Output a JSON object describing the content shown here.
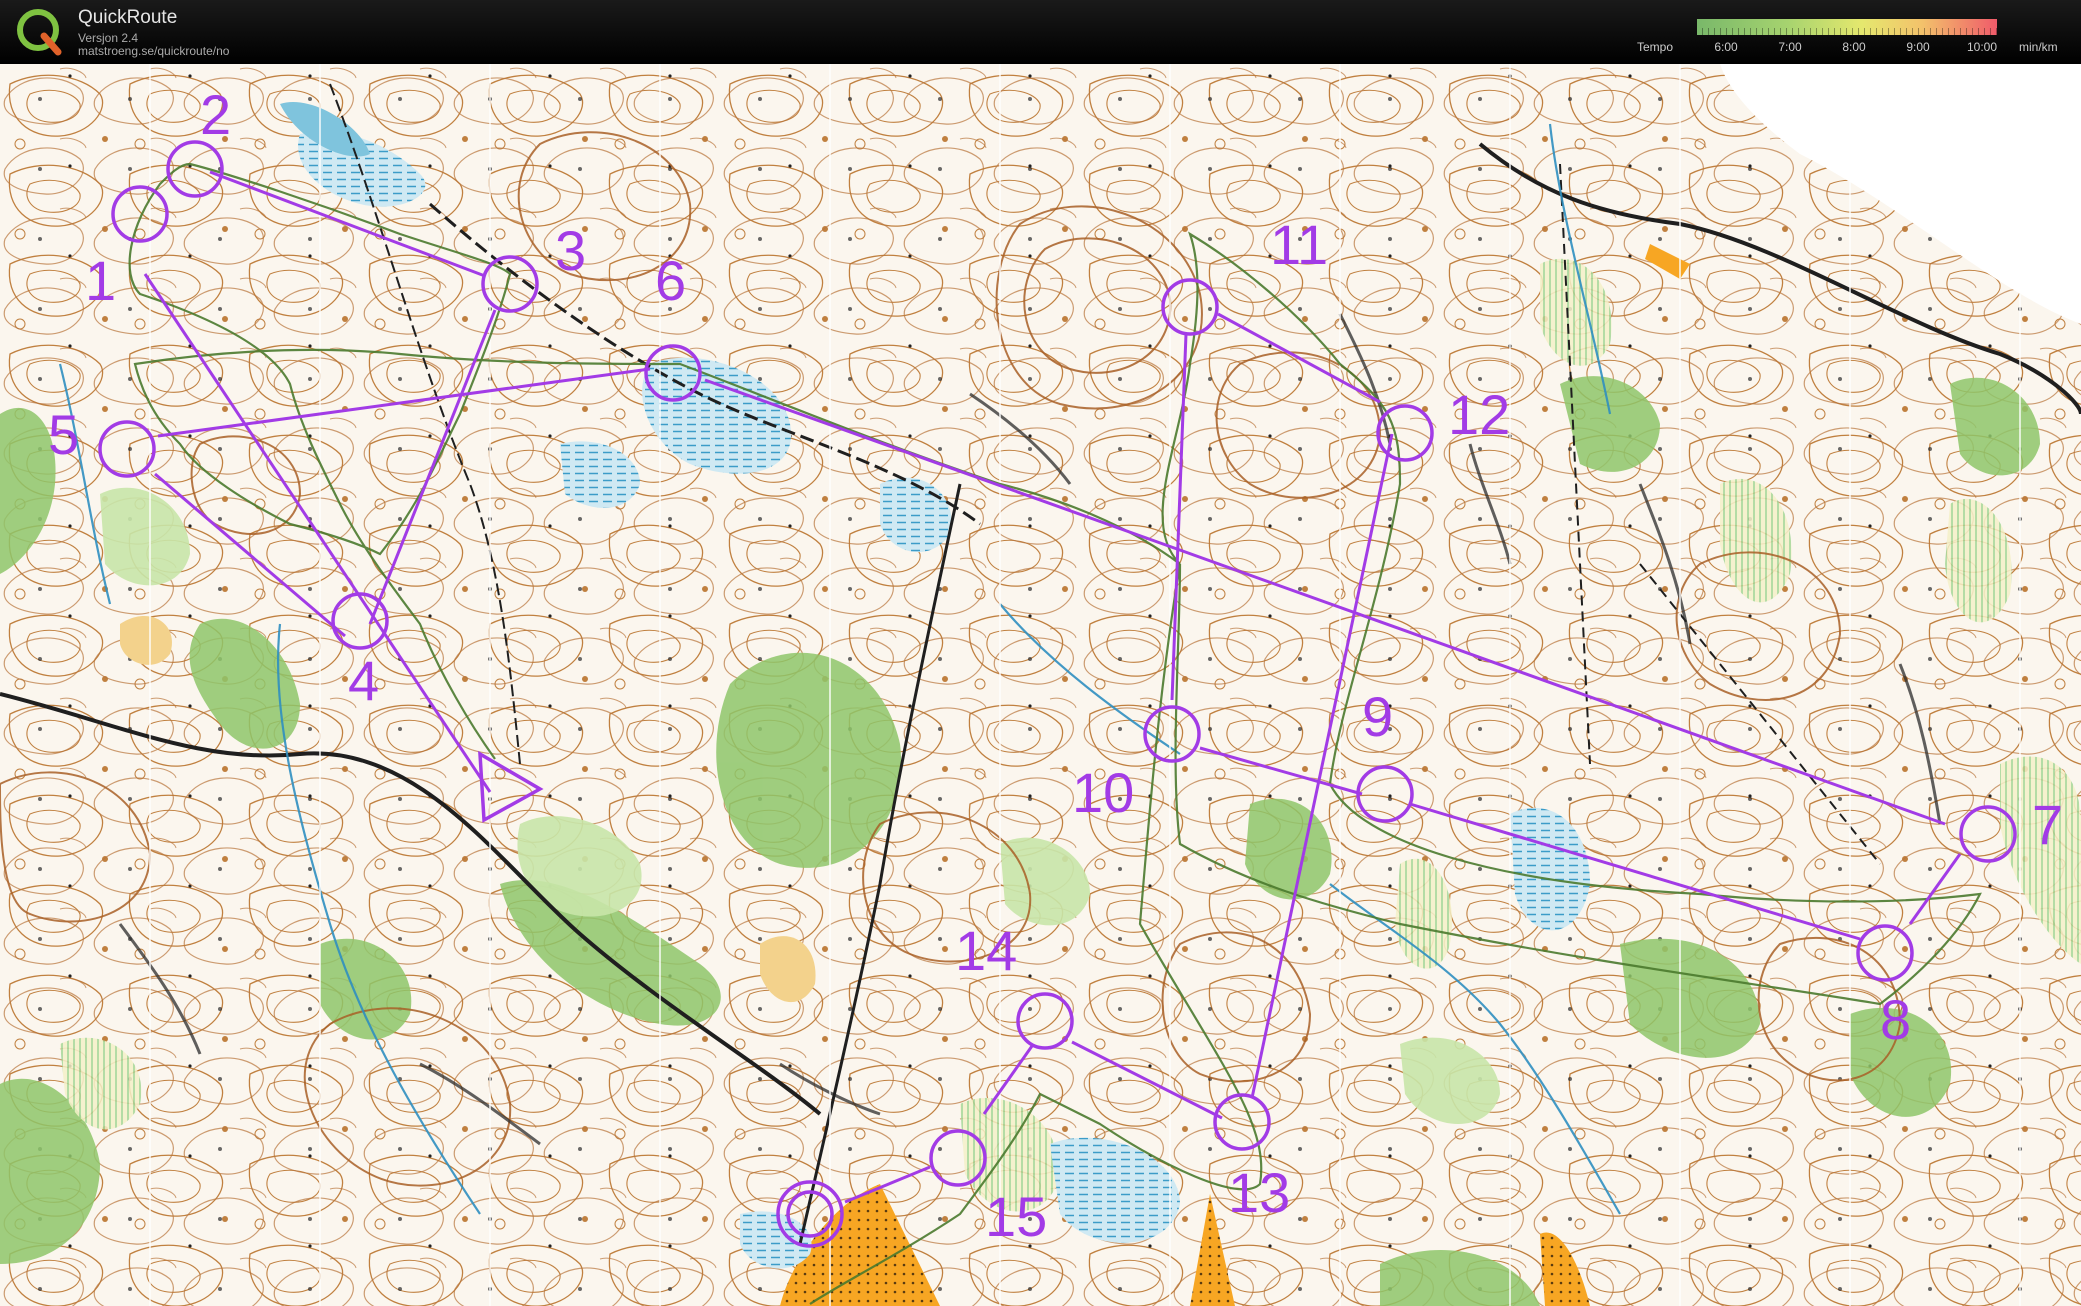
{
  "app": {
    "title": "QuickRoute",
    "version": "Versjon 2.4",
    "url": "matstroeng.se/quickroute/no"
  },
  "tempo_legend": {
    "label": "Tempo",
    "ticks": [
      "6:00",
      "7:00",
      "8:00",
      "9:00",
      "10:00"
    ],
    "unit": "min/km"
  },
  "course": {
    "color": "#a23be6",
    "controls": [
      {
        "label": "1"
      },
      {
        "label": "2"
      },
      {
        "label": "3"
      },
      {
        "label": "4"
      },
      {
        "label": "5"
      },
      {
        "label": "6"
      },
      {
        "label": "7"
      },
      {
        "label": "8"
      },
      {
        "label": "9"
      },
      {
        "label": "10"
      },
      {
        "label": "11"
      },
      {
        "label": "12"
      },
      {
        "label": "13"
      },
      {
        "label": "14"
      },
      {
        "label": "15"
      }
    ]
  },
  "colors": {
    "course": "#a23be6",
    "contour": "#b8743a",
    "forest_green": "#8ec66a",
    "marsh_blue": "#7fc4dd",
    "open_yellow": "#f5c542",
    "route_green": "#4a7a2e"
  }
}
